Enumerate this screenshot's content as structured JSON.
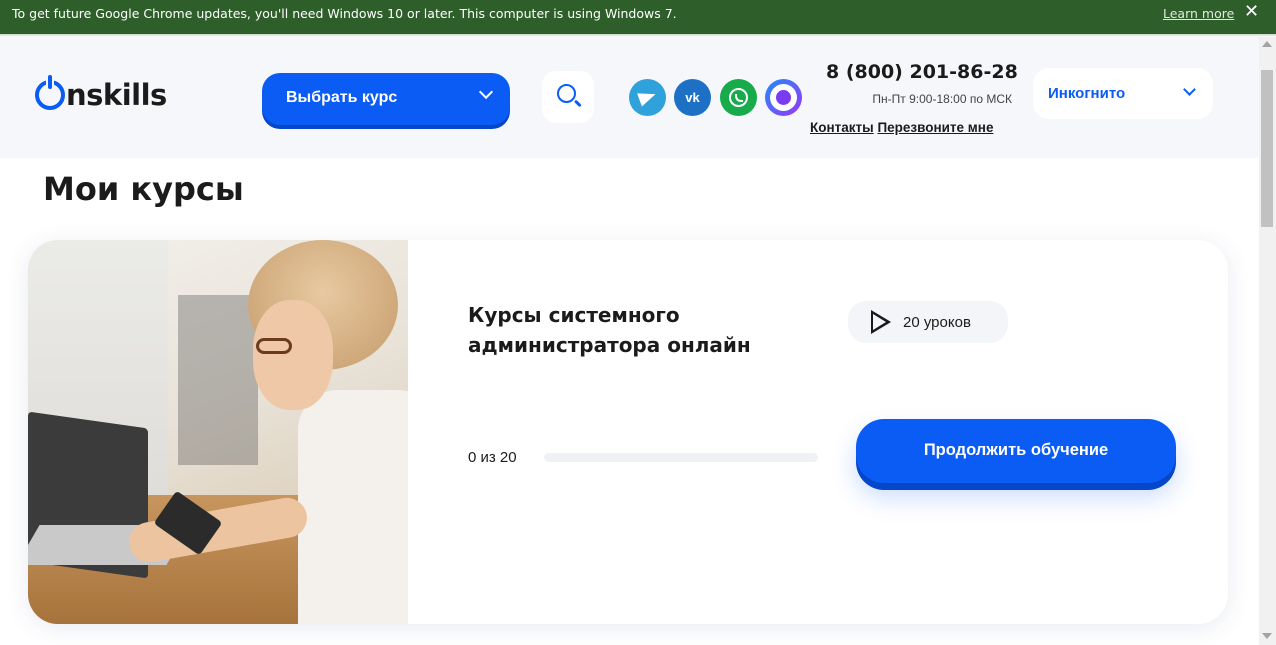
{
  "browser": {
    "infobar_message": "To get future Google Chrome updates, you'll need Windows 10 or later. This computer is using Windows 7.",
    "learn_more": "Learn more",
    "close_glyph": "✕"
  },
  "header": {
    "logo_text": "nskills",
    "course_button": "Выбрать курс",
    "social_labels": {
      "vk": "vk"
    },
    "phone": "8 (800) 201-86-28",
    "hours": "Пн-Пт 9:00-18:00 по МСК",
    "contacts_link": "Контакты",
    "callback_link": "Перезвоните мне",
    "user_name": "Инкогнито"
  },
  "main": {
    "page_title": "Мои курсы",
    "course": {
      "title": "Курсы системного администратора онлайн",
      "lessons_badge": "20 уроков",
      "progress_text": "0 из 20",
      "progress_fraction": 0,
      "continue_button": "Продолжить обучение"
    }
  },
  "colors": {
    "brand": "#0a5cf5",
    "infobar": "#2e5f2b",
    "header_bg": "#f6f7fb"
  },
  "icons": [
    "power-logo-icon",
    "chevron-down-icon",
    "search-icon",
    "telegram-icon",
    "vk-icon",
    "whatsapp-icon",
    "max-messenger-icon",
    "play-icon"
  ]
}
